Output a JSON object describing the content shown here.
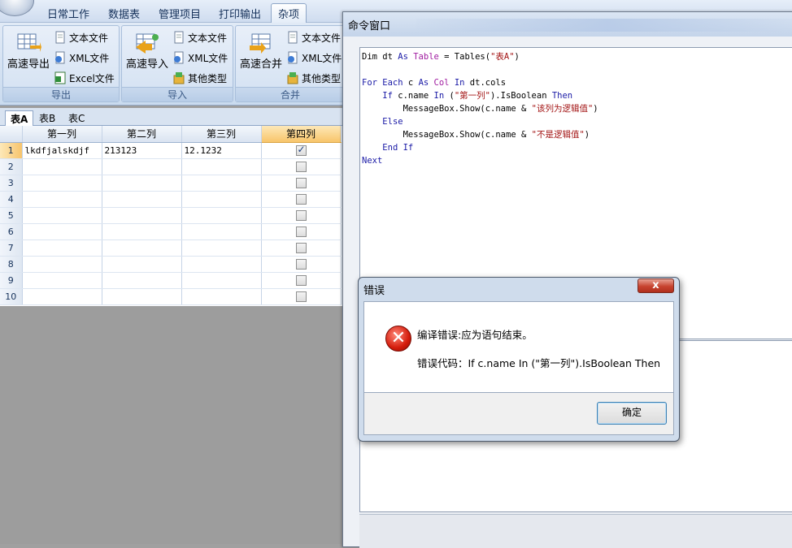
{
  "menu": {
    "tabs": [
      "日常工作",
      "数据表",
      "管理项目",
      "打印输出",
      "杂项"
    ],
    "active": "杂项"
  },
  "ribbon": {
    "groups": [
      {
        "label": "导出",
        "big": "高速导出",
        "items": [
          "文本文件",
          "XML文件",
          "Excel文件"
        ]
      },
      {
        "label": "导入",
        "big": "高速导入",
        "items": [
          "文本文件",
          "XML文件",
          "其他类型"
        ]
      },
      {
        "label": "合并",
        "big": "高速合并",
        "items": [
          "文本文件",
          "XML文件",
          "其他类型"
        ]
      }
    ]
  },
  "sheet_tabs": [
    "表A",
    "表B",
    "表C"
  ],
  "grid": {
    "columns": [
      "第一列",
      "第二列",
      "第三列",
      "第四列"
    ],
    "rows": [
      {
        "n": "1",
        "c1": "lkdfjalskdjf",
        "c2": "213123",
        "c3": "12.1232",
        "checked": true
      },
      {
        "n": "2",
        "c1": "",
        "c2": "",
        "c3": "",
        "checked": false
      },
      {
        "n": "3",
        "c1": "",
        "c2": "",
        "c3": "",
        "checked": false
      },
      {
        "n": "4",
        "c1": "",
        "c2": "",
        "c3": "",
        "checked": false
      },
      {
        "n": "5",
        "c1": "",
        "c2": "",
        "c3": "",
        "checked": false
      },
      {
        "n": "6",
        "c1": "",
        "c2": "",
        "c3": "",
        "checked": false
      },
      {
        "n": "7",
        "c1": "",
        "c2": "",
        "c3": "",
        "checked": false
      },
      {
        "n": "8",
        "c1": "",
        "c2": "",
        "c3": "",
        "checked": false
      },
      {
        "n": "9",
        "c1": "",
        "c2": "",
        "c3": "",
        "checked": false
      },
      {
        "n": "10",
        "c1": "",
        "c2": "",
        "c3": "",
        "checked": false
      }
    ]
  },
  "command_window": {
    "title": "命令窗口",
    "code_lines": [
      [
        [
          "",
          "Dim dt "
        ],
        [
          "kw",
          "As "
        ],
        [
          "ty",
          "Table"
        ],
        [
          "",
          " = Tables("
        ],
        [
          "st",
          "\"表A\""
        ],
        [
          "",
          ")"
        ]
      ],
      [],
      [
        [
          "kw",
          "For Each "
        ],
        [
          "",
          "c "
        ],
        [
          "kw",
          "As "
        ],
        [
          "ty",
          "Col "
        ],
        [
          "kw",
          "In "
        ],
        [
          "",
          "dt.cols"
        ]
      ],
      [
        [
          "",
          "    "
        ],
        [
          "kw",
          "If "
        ],
        [
          "",
          "c.name "
        ],
        [
          "kw",
          "In "
        ],
        [
          "",
          "("
        ],
        [
          "st",
          "\"第一列\""
        ],
        [
          "",
          ").IsBoolean "
        ],
        [
          "kw",
          "Then"
        ]
      ],
      [
        [
          "",
          "        MessageBox.Show(c.name & "
        ],
        [
          "st",
          "\"该列为逻辑值\""
        ],
        [
          "",
          ")"
        ]
      ],
      [
        [
          "",
          "    "
        ],
        [
          "kw",
          "Else"
        ]
      ],
      [
        [
          "",
          "        MessageBox.Show(c.name & "
        ],
        [
          "st",
          "\"不是逻辑值\""
        ],
        [
          "",
          ")"
        ]
      ],
      [
        [
          "",
          "    "
        ],
        [
          "kw",
          "End If"
        ]
      ],
      [
        [
          "kw",
          "Next"
        ]
      ]
    ]
  },
  "dialog": {
    "title": "错误",
    "close_glyph": "x",
    "message": "编译错误:应为语句结束。",
    "detail": "错误代码：If c.name In (\"第一列\").IsBoolean Then",
    "ok_label": "确定",
    "icon": "error-icon"
  }
}
